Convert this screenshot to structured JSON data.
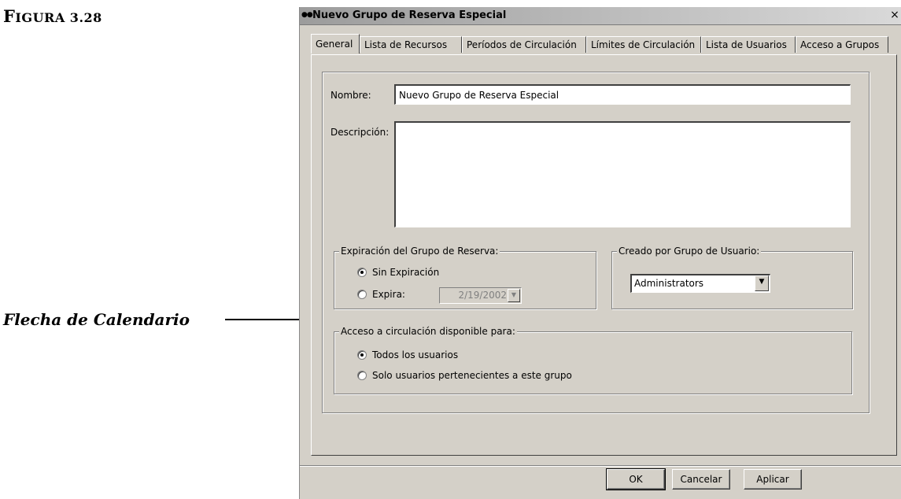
{
  "figure": {
    "label_initial": "F",
    "label_rest": "IGURA 3.28",
    "callout_text": "Flecha de Calendario"
  },
  "window": {
    "title": "Nuevo Grupo de Reserva Especial",
    "close_glyph": "×"
  },
  "tabs": [
    {
      "label": "General",
      "active": true
    },
    {
      "label": "Lista de Recursos"
    },
    {
      "label": "Períodos de Circulación"
    },
    {
      "label": "Límites de Circulación"
    },
    {
      "label": "Lista de Usuarios"
    },
    {
      "label": "Acceso a Grupos"
    }
  ],
  "general": {
    "name_label": "Nombre:",
    "name_value": "Nuevo Grupo de Reserva Especial",
    "description_label": "Descripción:",
    "description_value": ""
  },
  "expiration": {
    "legend": "Expiración del Grupo de Reserva:",
    "option_none": "Sin Expiración",
    "option_expires": "Expira:",
    "selected": "none",
    "date_value": "2/19/2002"
  },
  "created_by": {
    "legend": "Creado por Grupo de Usuario:",
    "selected_value": "Administrators"
  },
  "access": {
    "legend": "Acceso a circulación disponible para:",
    "option_all": "Todos los usuarios",
    "option_group": "Solo usuarios pertenecientes a este grupo",
    "selected": "all"
  },
  "buttons": {
    "ok": "OK",
    "cancel": "Cancelar",
    "apply": "Aplicar"
  },
  "colors": {
    "dialog_face": "#d4d0c8",
    "title_gradient_start": "#9c9c9c",
    "title_gradient_end": "#d9d9d9"
  },
  "icons": {
    "title": "title-icon",
    "close": "close-icon",
    "calendar_dropdown": "chevron-down-icon",
    "combo_dropdown": "chevron-down-icon"
  }
}
